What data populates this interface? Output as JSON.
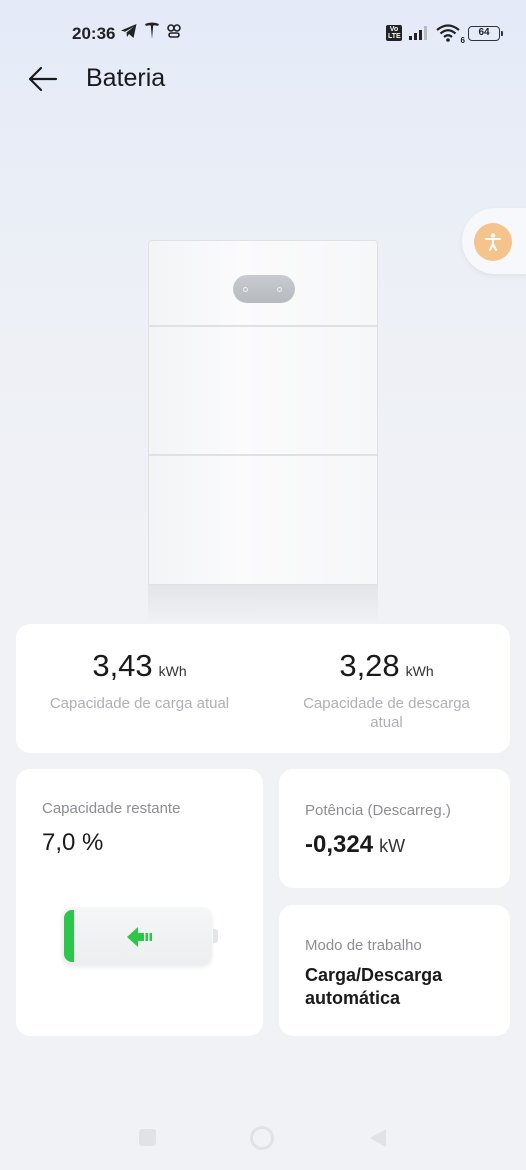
{
  "status_bar": {
    "time": "20:36",
    "left_icons": [
      "telegram-icon",
      "tesla-icon",
      "app-icon"
    ],
    "volte": "Vo LTE",
    "wifi_sub": "6",
    "battery_level": "64"
  },
  "header": {
    "back_icon": "arrow-left-icon",
    "title": "Bateria"
  },
  "floating": {
    "icon": "accessibility-icon",
    "color": "#f4c48c"
  },
  "capacity": {
    "charge": {
      "value": "3,43",
      "unit": "kWh",
      "label": "Capacidade de carga atual"
    },
    "discharge": {
      "value": "3,28",
      "unit": "kWh",
      "label": "Capacidade de descarga atual"
    }
  },
  "remaining": {
    "label": "Capacidade restante",
    "value": "7,0 %",
    "level_fraction": 0.07,
    "fill_color": "#2ec64a"
  },
  "power": {
    "label": "Potência (Descarreg.)",
    "value": "-0,324",
    "unit": "kW"
  },
  "mode": {
    "label": "Modo de trabalho",
    "value": "Carga/Descarga automática"
  },
  "nav": {
    "icons": [
      "recents-square-icon",
      "home-circle-icon",
      "back-triangle-icon"
    ]
  }
}
